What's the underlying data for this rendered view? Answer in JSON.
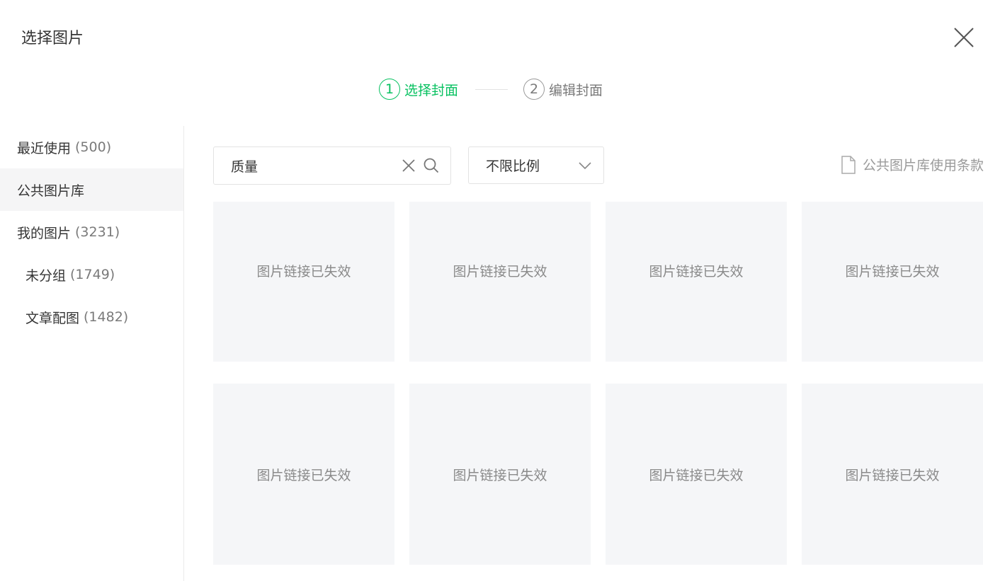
{
  "dialog": {
    "title": "选择图片"
  },
  "steps": [
    {
      "num": "1",
      "label": "选择封面",
      "active": true
    },
    {
      "num": "2",
      "label": "编辑封面",
      "active": false
    }
  ],
  "sidebar": {
    "items": [
      {
        "label": "最近使用",
        "count": "(500)"
      },
      {
        "label": "公共图片库",
        "count": ""
      },
      {
        "label": "我的图片",
        "count": "(3231)"
      },
      {
        "label": "未分组",
        "count": "(1749)"
      },
      {
        "label": "文章配图",
        "count": "(1482)"
      }
    ]
  },
  "search": {
    "value": "质量"
  },
  "ratio": {
    "selected": "不限比例"
  },
  "terms": {
    "label": "公共图片库使用条款"
  },
  "tiles": [
    "图片链接已失效",
    "图片链接已失效",
    "图片链接已失效",
    "图片链接已失效",
    "图片链接已失效",
    "图片链接已失效",
    "图片链接已失效",
    "图片链接已失效"
  ],
  "colors": {
    "accent": "#07c160",
    "tile_bg": "#f5f6f8",
    "active_bg": "#f5f5f6"
  }
}
